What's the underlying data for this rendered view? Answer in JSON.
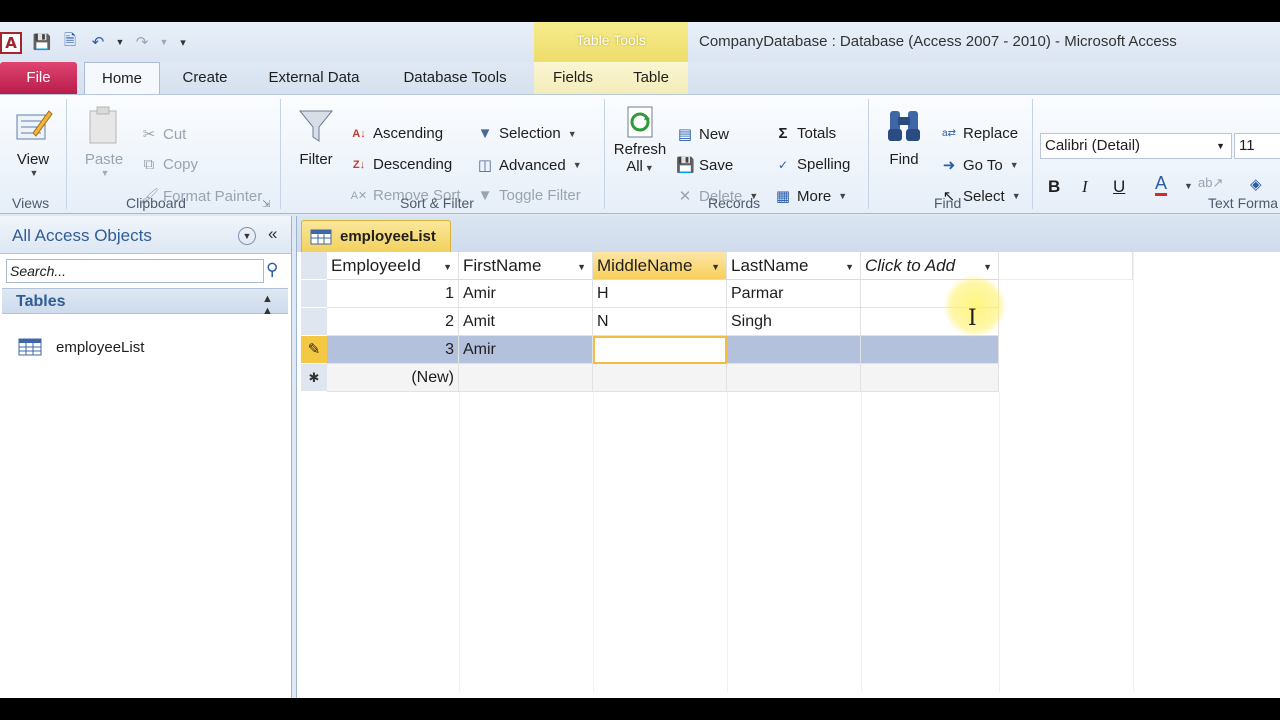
{
  "app": {
    "icon_letter": "A",
    "window_title": "CompanyDatabase : Database (Access 2007 - 2010)  -  Microsoft Access",
    "context_tab_header": "Table Tools"
  },
  "qat": [
    "save-icon",
    "save-as-icon",
    "undo-icon",
    "redo-icon",
    "customize-icon"
  ],
  "tabs": {
    "file": "File",
    "home": "Home",
    "create": "Create",
    "external_data": "External Data",
    "database_tools": "Database Tools",
    "fields": "Fields",
    "table": "Table"
  },
  "ribbon": {
    "views": {
      "view": "View",
      "label": "Views"
    },
    "clipboard": {
      "paste": "Paste",
      "cut": "Cut",
      "copy": "Copy",
      "format_painter": "Format Painter",
      "label": "Clipboard"
    },
    "sort_filter": {
      "filter": "Filter",
      "ascending": "Ascending",
      "descending": "Descending",
      "remove_sort": "Remove Sort",
      "selection": "Selection",
      "advanced": "Advanced",
      "toggle_filter": "Toggle Filter",
      "label": "Sort & Filter"
    },
    "records": {
      "refresh_all_1": "Refresh",
      "refresh_all_2": "All",
      "new": "New",
      "save": "Save",
      "delete": "Delete",
      "totals": "Totals",
      "spelling": "Spelling",
      "more": "More",
      "label": "Records"
    },
    "find": {
      "find": "Find",
      "replace": "Replace",
      "go_to": "Go To",
      "select": "Select",
      "label": "Find"
    },
    "text_formatting": {
      "font_name": "Calibri (Detail)",
      "font_size": "11",
      "bold": "B",
      "italic": "I",
      "underline": "U",
      "label": "Text Forma"
    }
  },
  "nav": {
    "title": "All Access Objects",
    "search_placeholder": "Search...",
    "group": "Tables",
    "items": [
      {
        "label": "employeeList"
      }
    ]
  },
  "document": {
    "tab_label": "employeeList",
    "columns": [
      "EmployeeId",
      "FirstName",
      "MiddleName",
      "LastName",
      "Click to Add"
    ],
    "rows": [
      {
        "id": "1",
        "first": "Amir",
        "middle": "H",
        "last": "Parmar"
      },
      {
        "id": "2",
        "first": "Amit",
        "middle": "N",
        "last": "Singh"
      },
      {
        "id": "3",
        "first": "Amir",
        "middle": "",
        "last": ""
      }
    ],
    "new_row_label": "(New)",
    "new_row_marker": "✱",
    "edit_marker": "✎"
  },
  "colors": {
    "file_tab": "#c8224f",
    "accent": "#2f5d95",
    "active_header": "#f8cf5b",
    "current_row": "#b4c1dc"
  }
}
